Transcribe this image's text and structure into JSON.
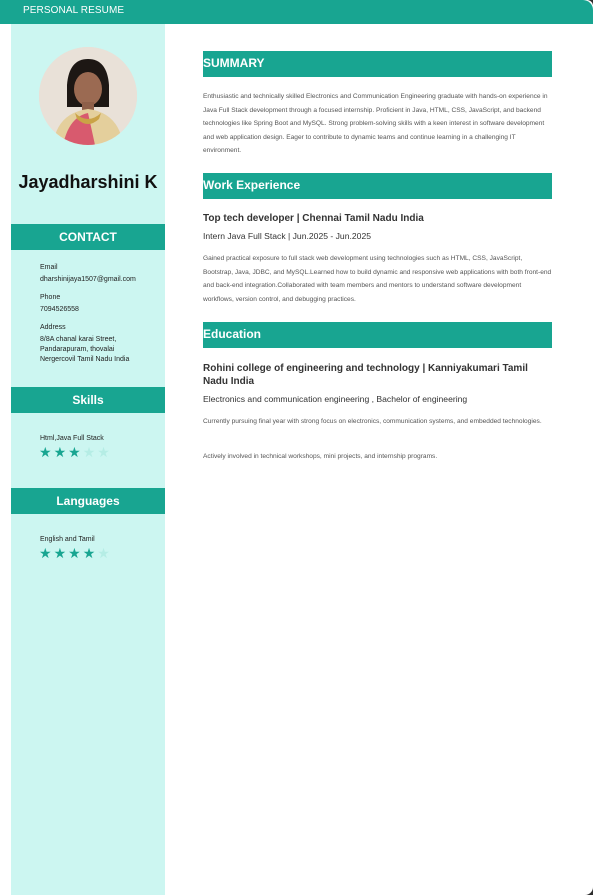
{
  "header": {
    "title": "PERSONAL RESUME"
  },
  "profile": {
    "name": "Jayadharshini K"
  },
  "contact": {
    "heading": "CONTACT",
    "email_label": "Email",
    "email": "dharshinijaya1507@gmail.com",
    "phone_label": "Phone",
    "phone": "7094526558",
    "address_label": "Address",
    "address_lines": [
      "8/8A chanal karai Street,",
      "Pandarapuram, thovalai",
      "Nergercovil Tamil Nadu India"
    ]
  },
  "skills": {
    "heading": "Skills",
    "items": [
      {
        "name": "Html,Java Full Stack",
        "rating": 3,
        "max": 5
      }
    ]
  },
  "languages": {
    "heading": "Languages",
    "items": [
      {
        "name": "English and Tamil",
        "rating": 4,
        "max": 5
      }
    ]
  },
  "summary": {
    "heading": "SUMMARY",
    "text": "Enthusiastic and technically skilled Electronics and Communication Engineering graduate with hands-on experience in Java Full Stack development through a focused internship. Proficient in Java, HTML, CSS, JavaScript, and backend technologies like Spring Boot and MySQL. Strong problem-solving skills with a keen interest in software development and web application design. Eager to contribute to dynamic teams and continue learning in a challenging IT environment."
  },
  "work": {
    "heading": "Work Experience",
    "jobs": [
      {
        "title_line": "Top tech developer   |   Chennai Tamil Nadu India",
        "sub_line": "Intern Java Full Stack  |   Jun.2025 - Jun.2025",
        "description": "Gained practical exposure to full stack web development using technologies such as HTML, CSS, JavaScript, Bootstrap, Java, JDBC, and MySQL.Learned how to build dynamic and responsive web applications with both front-end and back-end integration.Collaborated with team members and mentors to understand software development workflows, version control, and debugging practices."
      }
    ]
  },
  "education": {
    "heading": "Education",
    "items": [
      {
        "title_line": "Rohini college of engineering and technology   |   Kanniyakumari Tamil Nadu India",
        "sub_line": "Electronics and communication engineering , Bachelor of engineering",
        "notes": [
          "Currently pursuing final year with strong focus on electronics, communication systems, and embedded technologies.",
          "Actively involved in technical workshops, mini projects, and internship programs."
        ]
      }
    ]
  },
  "colors": {
    "accent": "#18a591",
    "sidebar_bg": "#ccf6f1",
    "star_off": "#b5ede5"
  }
}
